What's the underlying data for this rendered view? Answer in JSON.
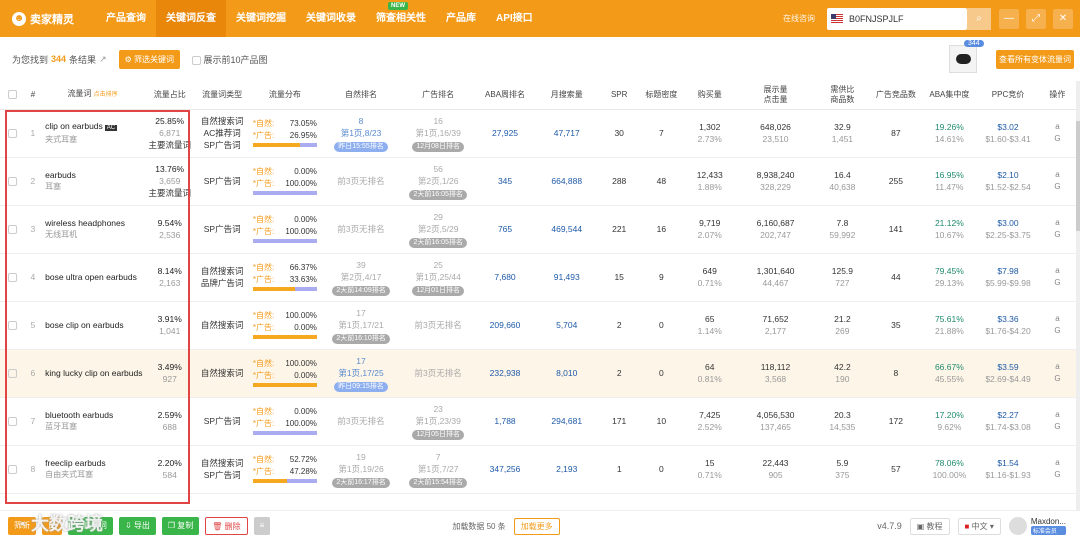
{
  "app": {
    "logo": "卖家精灵"
  },
  "nav": {
    "items": [
      {
        "label": "产品查询"
      },
      {
        "label": "关键词反查",
        "active": true
      },
      {
        "label": "关键词挖掘"
      },
      {
        "label": "关键词收录"
      },
      {
        "label": "筛查相关性",
        "badge": "NEW"
      },
      {
        "label": "产品库"
      },
      {
        "label": "API接口"
      }
    ]
  },
  "header": {
    "site_link": "在线咨询",
    "asin": "B0FNJSPJLF"
  },
  "summary": {
    "prefix": "为您找到",
    "count": "344",
    "suffix": "条结果",
    "filter_button": "筛选关键词",
    "top10_label": "展示前10产品图",
    "product_badge": "344",
    "view_all_button": "查看所有变体流量词"
  },
  "columns": {
    "kw": "流量词",
    "kw_hint": "点击排序",
    "share": "流量占比",
    "type": "流量词类型",
    "dist": "流量分布",
    "natural": "自然排名",
    "ad": "广告排名",
    "aba": "ABA周排名",
    "month": "月搜索量",
    "spr": "SPR",
    "title": "标题密度",
    "buy": "购买量",
    "show": "展示量\n点击量",
    "need": "需供比\n商品数",
    "adcnt": "广告竞品数",
    "aba2": "ABA集中度",
    "ppc": "PPC竞价",
    "op": "操作"
  },
  "rows": [
    {
      "idx": "1",
      "en": "clip on earbuds",
      "ac": "AC",
      "cn": "夹式耳塞",
      "pct": "25.85%",
      "n": "6,871",
      "tag": "主要流量词",
      "type": "自然搜索词\nAC推荐词\nSP广告词",
      "nat": "73.05%",
      "ad": "26.95%",
      "natfill": 0.73,
      "r1a": "8",
      "r1b": "第1页,8/23",
      "r1c": "昨日15:55排名",
      "r1blue": true,
      "r2a": "16",
      "r2b": "第1页,16/39",
      "r2c": "12月08日排名",
      "aba": "27,925",
      "month": "47,717",
      "spr": "30",
      "title": "7",
      "buy1": "1,302",
      "buy2": "2.73%",
      "s1": "648,026",
      "s2": "23,510",
      "n1": "32.9",
      "n2": "1,451",
      "adc": "87",
      "a1": "19.26%",
      "a2": "14.61%",
      "p1": "$3.02",
      "p2": "$1.60-$3.41"
    },
    {
      "idx": "2",
      "en": "earbuds",
      "cn": "耳塞",
      "pct": "13.76%",
      "n": "3,659",
      "tag": "主要流量词",
      "type": "SP广告词",
      "nat": "0.00%",
      "ad": "100.00%",
      "natfill": 0,
      "r1a": "",
      "r1b": "前3页无排名",
      "r1c": "",
      "r2a": "56",
      "r2b": "第2页,1/26",
      "r2c": "2天前16:05排名",
      "aba": "345",
      "month": "664,888",
      "spr": "288",
      "title": "48",
      "buy1": "12,433",
      "buy2": "1.88%",
      "s1": "8,938,240",
      "s2": "328,229",
      "n1": "16.4",
      "n2": "40,638",
      "adc": "255",
      "a1": "16.95%",
      "a2": "11.47%",
      "p1": "$2.10",
      "p2": "$1.52-$2.54"
    },
    {
      "idx": "3",
      "en": "wireless headphones",
      "cn": "无线耳机",
      "pct": "9.54%",
      "n": "2,536",
      "type": "SP广告词",
      "nat": "0.00%",
      "ad": "100.00%",
      "natfill": 0,
      "r1a": "",
      "r1b": "前3页无排名",
      "r1c": "",
      "r2a": "29",
      "r2b": "第2页,5/29",
      "r2c": "2天前16:05排名",
      "aba": "765",
      "month": "469,544",
      "spr": "221",
      "title": "16",
      "buy1": "9,719",
      "buy2": "2.07%",
      "s1": "6,160,687",
      "s2": "202,747",
      "n1": "7.8",
      "n2": "59,992",
      "adc": "141",
      "a1": "21.12%",
      "a2": "10.67%",
      "p1": "$3.00",
      "p2": "$2.25-$3.75"
    },
    {
      "idx": "4",
      "en": "bose ultra open earbuds",
      "cn": "",
      "pct": "8.14%",
      "n": "2,163",
      "type": "自然搜索词\n品牌广告词",
      "nat": "66.37%",
      "ad": "33.63%",
      "natfill": 0.66,
      "r1a": "39",
      "r1b": "第2页,4/17",
      "r1c": "2天前14:09排名",
      "r2a": "25",
      "r2b": "第1页,25/44",
      "r2c": "12月01日排名",
      "aba": "7,680",
      "month": "91,493",
      "spr": "15",
      "title": "9",
      "buy1": "649",
      "buy2": "0.71%",
      "s1": "1,301,640",
      "s2": "44,467",
      "n1": "125.9",
      "n2": "727",
      "adc": "44",
      "a1": "79.45%",
      "a2": "29.13%",
      "p1": "$7.98",
      "p2": "$5.99-$9.98"
    },
    {
      "idx": "5",
      "en": "bose clip on earbuds",
      "cn": "",
      "pct": "3.91%",
      "n": "1,041",
      "type": "自然搜索词",
      "nat": "100.00%",
      "ad": "0.00%",
      "natfill": 1,
      "r1a": "17",
      "r1b": "第1页,17/21",
      "r1c": "2天前16:10排名",
      "r2a": "",
      "r2b": "前3页无排名",
      "r2c": "",
      "aba": "209,660",
      "month": "5,704",
      "spr": "2",
      "title": "0",
      "buy1": "65",
      "buy2": "1.14%",
      "s1": "71,652",
      "s2": "2,177",
      "n1": "21.2",
      "n2": "269",
      "adc": "35",
      "a1": "75.61%",
      "a2": "21.88%",
      "p1": "$3.36",
      "p2": "$1.76-$4.20"
    },
    {
      "idx": "6",
      "en": "king lucky clip on earbuds",
      "cn": "",
      "pct": "3.49%",
      "n": "927",
      "type": "自然搜索词",
      "nat": "100.00%",
      "ad": "0.00%",
      "natfill": 1,
      "r1a": "17",
      "r1b": "第1页,17/25",
      "r1c": "昨日09:15排名",
      "r1blue": true,
      "r2a": "",
      "r2b": "前3页无排名",
      "r2c": "",
      "aba": "232,938",
      "month": "8,010",
      "spr": "2",
      "title": "0",
      "buy1": "64",
      "buy2": "0.81%",
      "s1": "118,112",
      "s2": "3,568",
      "n1": "42.2",
      "n2": "190",
      "adc": "8",
      "a1": "66.67%",
      "a2": "45.55%",
      "p1": "$3.59",
      "p2": "$2.69-$4.49",
      "hl": true
    },
    {
      "idx": "7",
      "en": "bluetooth earbuds",
      "cn": "蓝牙耳塞",
      "pct": "2.59%",
      "n": "688",
      "type": "SP广告词",
      "nat": "0.00%",
      "ad": "100.00%",
      "natfill": 0,
      "r1a": "",
      "r1b": "前3页无排名",
      "r1c": "",
      "r2a": "23",
      "r2b": "第1页,23/39",
      "r2c": "12月05日排名",
      "aba": "1,788",
      "month": "294,681",
      "spr": "171",
      "title": "10",
      "buy1": "7,425",
      "buy2": "2.52%",
      "s1": "4,056,530",
      "s2": "137,465",
      "n1": "20.3",
      "n2": "14,535",
      "adc": "172",
      "a1": "17.20%",
      "a2": "9.62%",
      "p1": "$2.27",
      "p2": "$1.74-$3.08"
    },
    {
      "idx": "8",
      "en": "freeclip earbuds",
      "cn": "自由夹式耳塞",
      "pct": "2.20%",
      "n": "584",
      "type": "自然搜索词\nSP广告词",
      "nat": "52.72%",
      "ad": "47.28%",
      "natfill": 0.53,
      "r1a": "19",
      "r1b": "第1页,19/26",
      "r1c": "2天前16:17排名",
      "r2a": "7",
      "r2b": "第1页,7/27",
      "r2c": "2天前15:54排名",
      "aba": "347,256",
      "month": "2,193",
      "spr": "1",
      "title": "0",
      "buy1": "15",
      "buy2": "0.71%",
      "s1": "22,443",
      "s2": "905",
      "n1": "5.9",
      "n2": "375",
      "adc": "57",
      "a1": "78.06%",
      "a2": "100.00%",
      "p1": "$1.54",
      "p2": "$1.16-$1.93"
    }
  ],
  "dist_labels": {
    "nat": "*自然:",
    "ad": "*广告:"
  },
  "bottom": {
    "b1": "筛新",
    "b2": "比",
    "b3": "高频词",
    "b4": "导出",
    "b5": "复制",
    "b6": "删除",
    "loaded": "加载数据 50 条",
    "loadmore": "加载更多",
    "version": "v4.7.9",
    "tutorial": "教程",
    "lang": "中文",
    "user": "Maxdon...",
    "level": "标准会员",
    "watermark": "大数跨境"
  },
  "colors": {
    "brand": "#f39b19",
    "nat_bar": "#f7a821",
    "ad_bar": "#a9acf0",
    "outline": "#e04444"
  }
}
